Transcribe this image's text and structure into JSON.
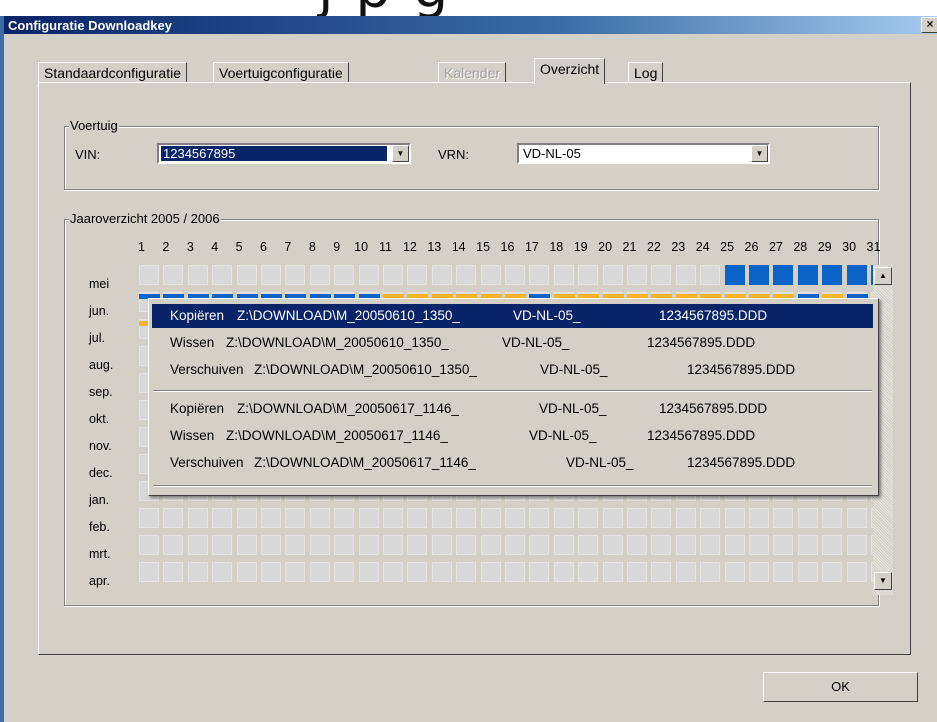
{
  "background_text": "j   p   g",
  "window": {
    "title": "Configuratie Downloadkey",
    "close_glyph": "×"
  },
  "tabs": [
    {
      "label": "Standaardconfiguratie",
      "state": "normal"
    },
    {
      "label": "Voertuigconfiguratie",
      "state": "normal"
    },
    {
      "label": "Kalender",
      "state": "disabled"
    },
    {
      "label": "Overzicht",
      "state": "active"
    },
    {
      "label": "Log",
      "state": "normal"
    }
  ],
  "vehicle": {
    "group_label": "Voertuig",
    "vin_label": "VIN:",
    "vin_value": "1234567895",
    "vrn_label": "VRN:",
    "vrn_value": "VD-NL-05"
  },
  "year_overview": {
    "group_label": "Jaaroverzicht 2005 / 2006",
    "days": [
      "1",
      "2",
      "3",
      "4",
      "5",
      "6",
      "7",
      "8",
      "9",
      "10",
      "11",
      "12",
      "13",
      "14",
      "15",
      "16",
      "17",
      "18",
      "19",
      "20",
      "21",
      "22",
      "23",
      "24",
      "25",
      "26",
      "27",
      "28",
      "29",
      "30",
      "31"
    ],
    "months": [
      "mei",
      "jun.",
      "jul.",
      "aug.",
      "sep.",
      "okt.",
      "nov.",
      "dec.",
      "jan.",
      "feb.",
      "mrt.",
      "apr."
    ],
    "colors": {
      "download": "#0a64c8",
      "activity": "#f8b42a",
      "empty": "#d8d8d8"
    },
    "may_downloads_days": [
      25,
      26,
      27,
      28,
      29,
      30,
      31
    ],
    "june_row": [
      "blue",
      "blue",
      "blue",
      "blue",
      "blue",
      "blue",
      "blue",
      "blue",
      "blue",
      "blue",
      "orange",
      "orange",
      "orange",
      "orange",
      "orange",
      "orange",
      "blue",
      "orange",
      "orange",
      "orange",
      "orange",
      "orange",
      "orange",
      "orange",
      "orange",
      "orange",
      "orange",
      "blue",
      "orange",
      "blue"
    ],
    "july_row": [
      "orange"
    ]
  },
  "context_menu": {
    "items": [
      {
        "action": "Kopiëren",
        "path": "Z:\\DOWNLOAD\\M_20050610_1350_",
        "vrn": "VD-NL-05_",
        "file": "1234567895.DDD",
        "highlighted": true
      },
      {
        "action": "Wissen",
        "path": "Z:\\DOWNLOAD\\M_20050610_1350_",
        "vrn": "VD-NL-05_",
        "file": "1234567895.DDD",
        "highlighted": false
      },
      {
        "action": "Verschuiven",
        "path": "Z:\\DOWNLOAD\\M_20050610_1350_",
        "vrn": "VD-NL-05_",
        "file": "1234567895.DDD",
        "highlighted": false
      },
      {
        "action": "Kopiëren",
        "path": "Z:\\DOWNLOAD\\M_20050617_1146_",
        "vrn": "VD-NL-05_",
        "file": "1234567895.DDD",
        "highlighted": false
      },
      {
        "action": "Wissen",
        "path": "Z:\\DOWNLOAD\\M_20050617_1146_",
        "vrn": "VD-NL-05_",
        "file": "1234567895.DDD",
        "highlighted": false
      },
      {
        "action": "Verschuiven",
        "path": "Z:\\DOWNLOAD\\M_20050617_1146_",
        "vrn": "VD-NL-05_",
        "file": "1234567895.DDD",
        "highlighted": false
      }
    ]
  },
  "ok_label": "OK",
  "icons": {
    "dropdown": "triangle-down",
    "scroll_up": "triangle-up",
    "scroll_down": "triangle-down",
    "close": "x"
  }
}
